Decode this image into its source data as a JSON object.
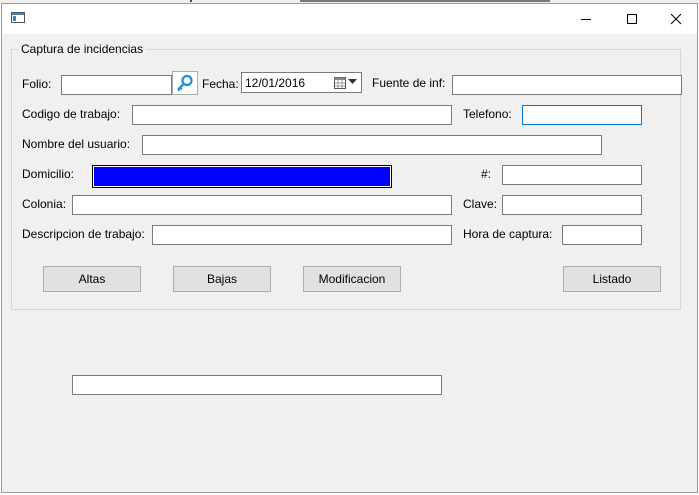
{
  "form": {
    "group_title": "Captura de incidencias",
    "folio": {
      "label": "Folio:",
      "value": ""
    },
    "fecha": {
      "label": "Fecha:",
      "value": "12/01/2016"
    },
    "fuente": {
      "label": "Fuente de inf:",
      "value": ""
    },
    "codigo_trabajo": {
      "label": "Codigo de trabajo:",
      "value": ""
    },
    "telefono": {
      "label": "Telefono:",
      "value": ""
    },
    "nombre_usuario": {
      "label": "Nombre del usuario:",
      "value": ""
    },
    "domicilio": {
      "label": "Domicilio:",
      "value": ""
    },
    "numero": {
      "label": "#:",
      "value": ""
    },
    "colonia": {
      "label": "Colonia:",
      "value": ""
    },
    "clave": {
      "label": "Clave:",
      "value": ""
    },
    "descripcion_trabajo": {
      "label": "Descripcion de trabajo:",
      "value": ""
    },
    "hora_captura": {
      "label": "Hora de captura:",
      "value": ""
    }
  },
  "buttons": {
    "altas": "Altas",
    "bajas": "Bajas",
    "modificacion": "Modificacion",
    "listado": "Listado"
  },
  "bottom_field": {
    "value": ""
  },
  "icons": {
    "app": "window-icon",
    "search": "search-key-icon",
    "calendar": "calendar-icon",
    "dropdown": "chevron-down-icon"
  },
  "colors": {
    "selected_field": "#0000ff",
    "focus_border": "#0078d7",
    "search_icon": "#1e90d6"
  }
}
